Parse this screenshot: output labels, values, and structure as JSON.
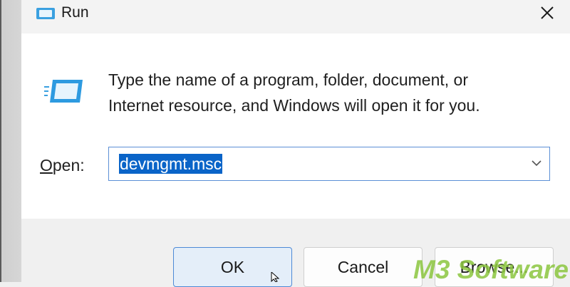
{
  "window": {
    "title": "Run",
    "icon": "run-app-icon",
    "close_icon": "close-icon"
  },
  "content": {
    "description_line1": "Type the name of a program, folder, document, or",
    "description_line2": "Internet resource, and Windows will open it for you.",
    "open_label_access_key": "O",
    "open_label_rest": "pen:",
    "open_value": "devmgmt.msc",
    "dropdown_icon": "chevron-down-icon"
  },
  "buttons": {
    "ok": "OK",
    "cancel": "Cancel",
    "browse": "Browse..."
  },
  "watermark": "M3 Software",
  "colors": {
    "accent": "#0a64c8",
    "ok_border": "#4d8ad6",
    "watermark": "#8cc63f"
  }
}
